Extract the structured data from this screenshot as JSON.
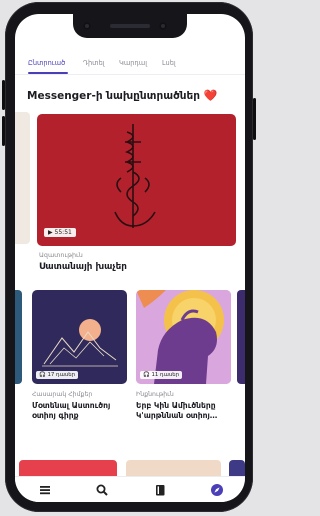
{
  "tabs": [
    {
      "label": "Ընտրուած",
      "active": true
    },
    {
      "label": "Դիտել",
      "active": false
    },
    {
      "label": "Կարդալ",
      "active": false
    },
    {
      "label": "Լսել",
      "active": false
    }
  ],
  "section": {
    "title": "Messenger-ի նախընտրածներ",
    "heart": "❤️"
  },
  "featured": {
    "duration": "55:51",
    "category": "Ազատութիւն",
    "title": "Սատանայի խաչեր"
  },
  "cards": [
    {
      "badge": "17 դասեր",
      "category": "Հասարակ Հիմքեր",
      "title": "Մօտենալ Աստուծոյ օտիոյ գիրք"
    },
    {
      "badge": "11 դասեր",
      "category": "Ինքնութիւն",
      "title": "Երբ Կին Ամիւծները Կ'արթննան օտիոյ…"
    }
  ],
  "nav": [
    {
      "icon": "menu-icon"
    },
    {
      "icon": "search-icon"
    },
    {
      "icon": "book-icon"
    },
    {
      "icon": "compass-icon",
      "active": true
    }
  ],
  "colors": {
    "accent": "#4b3fb8",
    "featured_bg": "#b3222c",
    "heart": "#d8233d"
  }
}
